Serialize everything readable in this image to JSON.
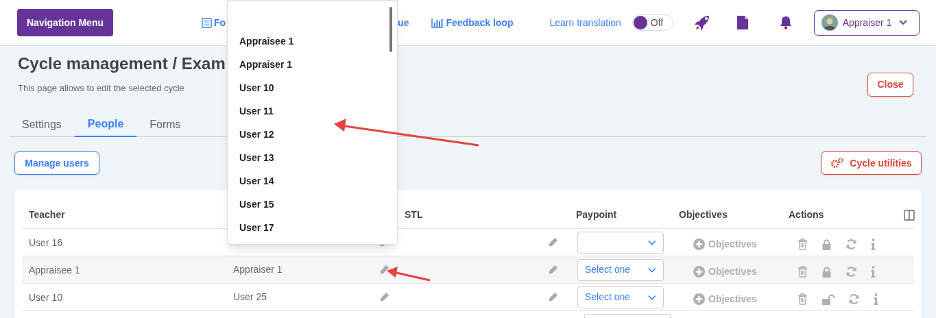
{
  "header": {
    "menu_button": "Navigation Menu",
    "links": [
      {
        "label": "Fo",
        "kind": "form"
      },
      {
        "label": "ue"
      },
      {
        "label": "Feedback loop",
        "kind": "chart"
      }
    ],
    "translation": {
      "label": "Learn translation",
      "on": false,
      "state_text": "Off"
    },
    "user": {
      "name": "Appraiser 1"
    }
  },
  "page": {
    "title": "Cycle management / Exam",
    "subtitle": "This page allows to edit the selected cycle",
    "close_button": "Close"
  },
  "tabs": [
    {
      "label": "Settings",
      "selected": false
    },
    {
      "label": "People",
      "selected": true
    },
    {
      "label": "Forms",
      "selected": false
    }
  ],
  "manage_users_button": "Manage users",
  "cycle_utilities_button": "Cycle utilities",
  "table": {
    "headers": {
      "column_1": "Teacher",
      "column_3": "STL",
      "column_4": "Paypoint",
      "column_5": "Objectives",
      "column_6": "Actions"
    },
    "rows": [
      {
        "teacher": "User 16",
        "paypoint": {},
        "objectives": "Objectives",
        "locked": true
      },
      {
        "teacher": "Appraisee 1",
        "column_2": "Appraiser 1",
        "paypoint": {
          "placeholder": "Select one"
        },
        "objectives": "Objectives",
        "locked": true
      },
      {
        "teacher": "User 10",
        "column_2": "User 25",
        "paypoint": {
          "placeholder": "Select one"
        },
        "objectives": "Objectives",
        "locked": false
      }
    ]
  },
  "dropdown": {
    "items": [
      "Appraisee 1",
      "Appraiser 1",
      "User 10",
      "User 11",
      "User 12",
      "User 13",
      "User 14",
      "User 15",
      "User 17"
    ]
  }
}
